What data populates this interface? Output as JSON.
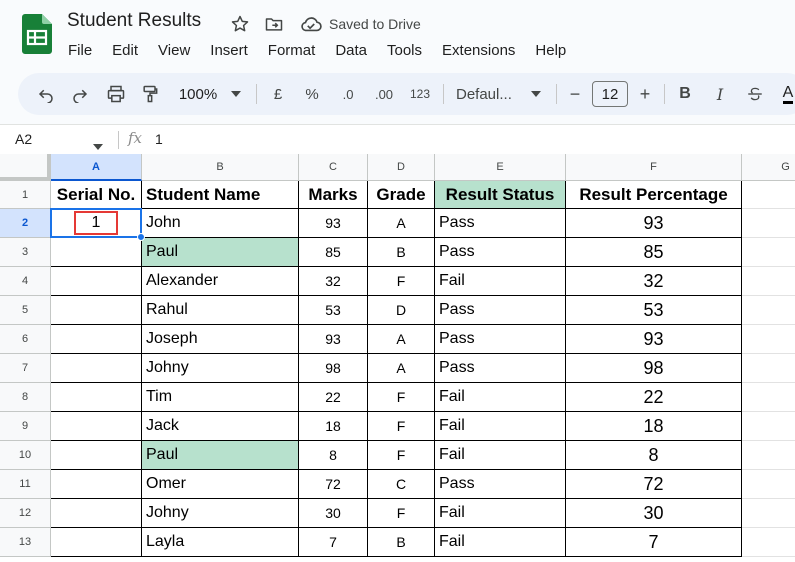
{
  "app": {
    "title": "Student Results",
    "saved_status": "Saved to Drive",
    "menu": [
      "File",
      "Edit",
      "View",
      "Insert",
      "Format",
      "Data",
      "Tools",
      "Extensions",
      "Help"
    ]
  },
  "toolbar": {
    "zoom": "100%",
    "currency": "£",
    "percent": "%",
    "decrease_decimal": ".0",
    "increase_decimal": ".00",
    "number_format": "123",
    "font": "Defaul...",
    "font_size": "12",
    "minus": "−",
    "plus": "+",
    "bold": "B",
    "italic": "I",
    "text_color": "A"
  },
  "formula_bar": {
    "cell_ref": "A2",
    "fx": "fx",
    "value": "1"
  },
  "colors": {
    "green_fill": "#b7e1cd",
    "selection": "#1a73e8",
    "highlight_box": "#e53935",
    "sheets_green": "#188038"
  },
  "sheet": {
    "columns": [
      "A",
      "B",
      "C",
      "D",
      "E",
      "F",
      "G"
    ],
    "row_numbers": [
      "1",
      "2",
      "3",
      "4",
      "5",
      "6",
      "7",
      "8",
      "9",
      "10",
      "11",
      "12",
      "13"
    ],
    "headers": [
      "Serial No.",
      "Student  Name",
      "Marks",
      "Grade",
      "Result Status",
      "Result Percentage"
    ],
    "rows": [
      {
        "serial": "1",
        "name": "John",
        "marks": "93",
        "grade": "A",
        "status": "Pass",
        "percentage": "93"
      },
      {
        "serial": "",
        "name": "Paul",
        "marks": "85",
        "grade": "B",
        "status": "Pass",
        "percentage": "85"
      },
      {
        "serial": "",
        "name": "Alexander",
        "marks": "32",
        "grade": "F",
        "status": "Fail",
        "percentage": "32"
      },
      {
        "serial": "",
        "name": "Rahul",
        "marks": "53",
        "grade": "D",
        "status": "Pass",
        "percentage": "53"
      },
      {
        "serial": "",
        "name": "Joseph",
        "marks": "93",
        "grade": "A",
        "status": "Pass",
        "percentage": "93"
      },
      {
        "serial": "",
        "name": "Johny",
        "marks": "98",
        "grade": "A",
        "status": "Pass",
        "percentage": "98"
      },
      {
        "serial": "",
        "name": "Tim",
        "marks": "22",
        "grade": "F",
        "status": "Fail",
        "percentage": "22"
      },
      {
        "serial": "",
        "name": "Jack",
        "marks": "18",
        "grade": "F",
        "status": "Fail",
        "percentage": "18"
      },
      {
        "serial": "",
        "name": "Paul",
        "marks": "8",
        "grade": "F",
        "status": "Fail",
        "percentage": "8"
      },
      {
        "serial": "",
        "name": "Omer",
        "marks": "72",
        "grade": "C",
        "status": "Pass",
        "percentage": "72"
      },
      {
        "serial": "",
        "name": "Johny",
        "marks": "30",
        "grade": "F",
        "status": "Fail",
        "percentage": "30"
      },
      {
        "serial": "",
        "name": "Layla",
        "marks": "7",
        "grade": "B",
        "status": "Fail",
        "percentage": "7"
      }
    ]
  }
}
